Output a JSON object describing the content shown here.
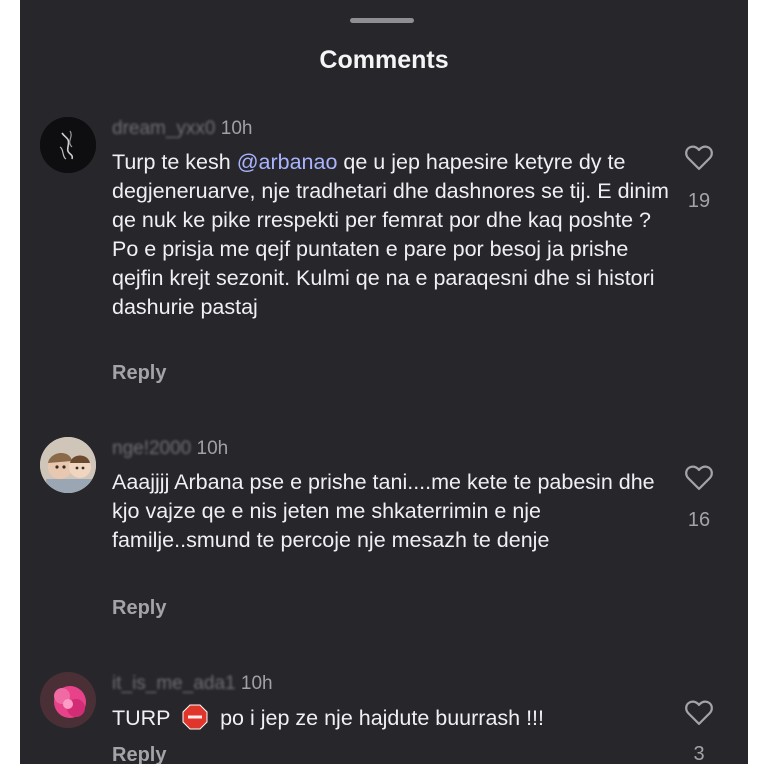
{
  "sheet": {
    "title": "Comments"
  },
  "comments": [
    {
      "username": "dream_yxx0",
      "time": "10h",
      "text_before": "Turp te kesh ",
      "mention": "@arbanao",
      "text_after": " qe u jep hapesire ketyre dy te degjeneruarve, nje tradhetari dhe dashnores se tij. E dinim qe nuk ke pike rrespekti per femrat por dhe kaq poshte ? Po e prisja me qejf puntaten e pare por besoj ja prishe qejfin krejt sezonit. Kulmi qe na e paraqesni dhe si histori dashurie pastaj",
      "reply_label": "Reply",
      "likes": "19",
      "avatar_icon": "dark-avatar-icon"
    },
    {
      "username": "nge!2000",
      "time": "10h",
      "text": "Aaajjjj Arbana pse e prishe tani....me kete te pabesin dhe kjo vajze qe e nis jeten me shkaterrimin e nje familje..smund te percoje nje mesazh te denje",
      "reply_label": "Reply",
      "likes": "16",
      "avatar_icon": "children-photo-avatar-icon"
    },
    {
      "username": "it_is_me_ada1",
      "time": "10h",
      "text_before": "TURP ",
      "emoji": "stop-sign-emoji",
      "text_after": " po i jep ze nje hajdute buurrash !!!",
      "reply_label": "Reply",
      "likes": "3",
      "avatar_icon": "pink-flower-avatar-icon"
    }
  ],
  "colors": {
    "background": "#26262b",
    "text": "#f0f0f2",
    "muted": "#a3a3a8",
    "mention": "#a9b4ff"
  }
}
